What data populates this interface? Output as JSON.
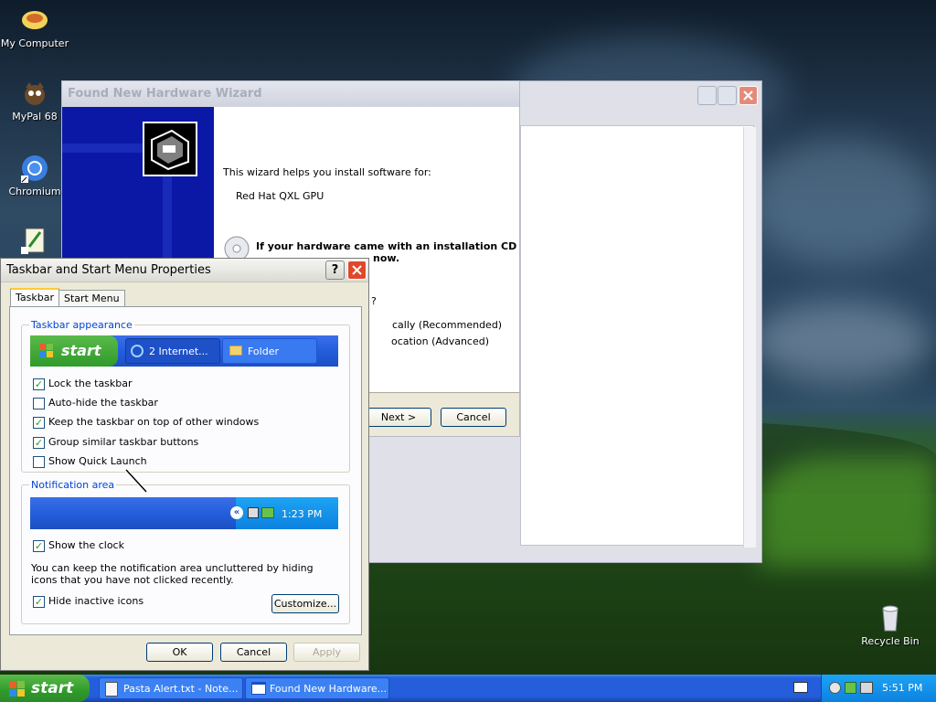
{
  "desktop": {
    "icons": [
      {
        "label": "My Computer",
        "icon": "my-computer-icon"
      },
      {
        "label": "MyPal 68",
        "icon": "mypal-icon"
      },
      {
        "label": "Chromium",
        "icon": "chromium-icon"
      },
      {
        "label": "",
        "icon": "notepadpp-icon"
      },
      {
        "label": "Recycle Bin",
        "icon": "recycle-bin-icon"
      }
    ]
  },
  "wizard": {
    "title": "Found New Hardware Wizard",
    "intro": "This wizard helps you install software for:",
    "device": "Red Hat QXL GPU",
    "cd_line1": "If your hardware came with an installation CD",
    "cd_line2": "now.",
    "question_fragment": "?",
    "option1_fragment": "cally (Recommended)",
    "option2_fragment": "ocation (Advanced)",
    "next_label": "Next >",
    "cancel_label": "Cancel"
  },
  "taskbar_props": {
    "title": "Taskbar and Start Menu Properties",
    "tabs": [
      "Taskbar",
      "Start Menu"
    ],
    "appearance_label": "Taskbar appearance",
    "preview": {
      "start_label": "start",
      "item1": "2 Internet...",
      "item2": "Folder"
    },
    "options": [
      {
        "label": "Lock the taskbar",
        "checked": true
      },
      {
        "label": "Auto-hide the taskbar",
        "checked": false
      },
      {
        "label": "Keep the taskbar on top of other windows",
        "checked": true
      },
      {
        "label": "Group similar taskbar buttons",
        "checked": true
      },
      {
        "label": "Show Quick Launch",
        "checked": false
      }
    ],
    "notification_label": "Notification area",
    "notif_preview_time": "1:23 PM",
    "show_clock": {
      "label": "Show the clock",
      "checked": true
    },
    "info_text": "You can keep the notification area uncluttered by hiding icons that you have not clicked recently.",
    "hide_inactive": {
      "label": "Hide inactive icons",
      "checked": true
    },
    "customize_label": "Customize...",
    "ok_label": "OK",
    "cancel_label": "Cancel",
    "apply_label": "Apply"
  },
  "taskbar": {
    "start_label": "start",
    "tasks": [
      {
        "label": "Pasta Alert.txt - Note...",
        "icon": "notepad-icon"
      },
      {
        "label": "Found New Hardware...",
        "icon": "wizard-window-icon"
      }
    ],
    "clock": "5:51 PM"
  },
  "colors": {
    "xp_blue": "#245edb",
    "start_green": "#2f9a2b",
    "group_label_blue": "#0046d5",
    "close_red": "#e0482a"
  }
}
